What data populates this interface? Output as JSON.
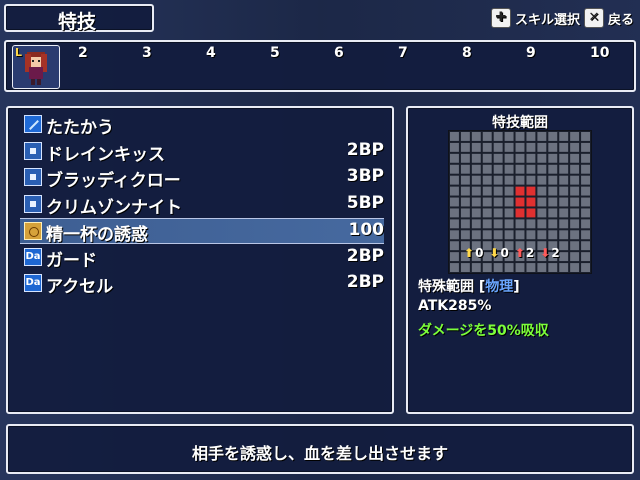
{
  "header": {
    "title": "特技",
    "skill_select_label": "スキル選択",
    "back_label": "戻る"
  },
  "party": {
    "leader_badge": "L",
    "slots": [
      "2",
      "3",
      "4",
      "5",
      "6",
      "7",
      "8",
      "9",
      "10"
    ]
  },
  "skills": [
    {
      "icon": "slash-icon",
      "name": "たたかう",
      "cost": ""
    },
    {
      "icon": "skill-square-icon",
      "name": "ドレインキッス",
      "cost": "2BP"
    },
    {
      "icon": "skill-square-icon",
      "name": "ブラッディクロー",
      "cost": "3BP"
    },
    {
      "icon": "skill-square-icon",
      "name": "クリムゾンナイト",
      "cost": "5BP"
    },
    {
      "icon": "charm-icon",
      "name": "精一杯の誘惑",
      "cost": "100"
    },
    {
      "icon": "da-icon",
      "name": "ガード",
      "cost": "2BP"
    },
    {
      "icon": "da-icon",
      "name": "アクセル",
      "cost": "2BP"
    }
  ],
  "da_badge": "Da",
  "range": {
    "title": "特技範囲",
    "grid_cols": 13,
    "grid_rows": 13,
    "highlight_cells": [
      [
        6,
        5
      ],
      [
        7,
        5
      ],
      [
        6,
        6
      ],
      [
        7,
        6
      ],
      [
        6,
        7
      ],
      [
        7,
        7
      ]
    ],
    "modifiers": [
      {
        "dir": "up",
        "color": "#ffd84a",
        "value": "0"
      },
      {
        "dir": "down",
        "color": "#ffd84a",
        "value": "0"
      },
      {
        "dir": "up",
        "color": "#ff5a5a",
        "value": "2"
      },
      {
        "dir": "down",
        "color": "#ff5a5a",
        "value": "2"
      }
    ],
    "type_line_prefix": "特殊範囲 [",
    "type_line_value": "物理",
    "type_line_suffix": "]",
    "atk_line": "ATK285%",
    "drain_line": "ダメージを50%吸収"
  },
  "description": "相手を誘惑し、血を差し出させます",
  "colors": {
    "panel_border": "#e9ecf5",
    "selection": "#46699f",
    "highlight_red": "#e03030",
    "accent_green": "#7cff3a",
    "accent_blue": "#6aa6ff"
  }
}
